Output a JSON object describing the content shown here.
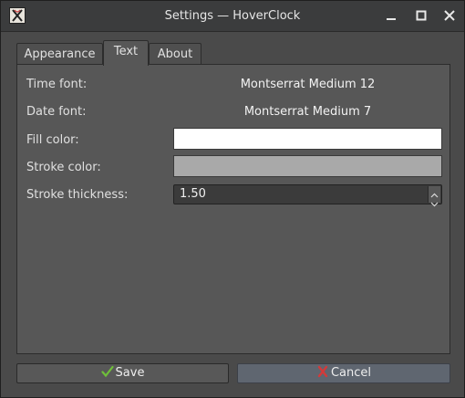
{
  "window": {
    "title": "Settings — HoverClock",
    "controls": {
      "minimize_icon": "minimize-icon",
      "maximize_icon": "maximize-icon",
      "close_icon": "close-icon"
    }
  },
  "tabs": [
    {
      "label": "Appearance",
      "active": false
    },
    {
      "label": "Text",
      "active": true
    },
    {
      "label": "About",
      "active": false
    }
  ],
  "form": {
    "time_font": {
      "label": "Time font:",
      "value": "Montserrat Medium 12"
    },
    "date_font": {
      "label": "Date font:",
      "value": "Montserrat Medium 7"
    },
    "fill_color": {
      "label": "Fill color:",
      "color": "#ffffff"
    },
    "stroke_color": {
      "label": "Stroke color:",
      "color": "#a9a9a9"
    },
    "stroke_thickness": {
      "label": "Stroke thickness:",
      "value": "1.50"
    }
  },
  "buttons": {
    "save": {
      "label": "Save",
      "icon": "checkmark-icon",
      "icon_color": "#6fbf3a"
    },
    "cancel": {
      "label": "Cancel",
      "icon": "cross-icon",
      "icon_color": "#d23a3a"
    }
  }
}
